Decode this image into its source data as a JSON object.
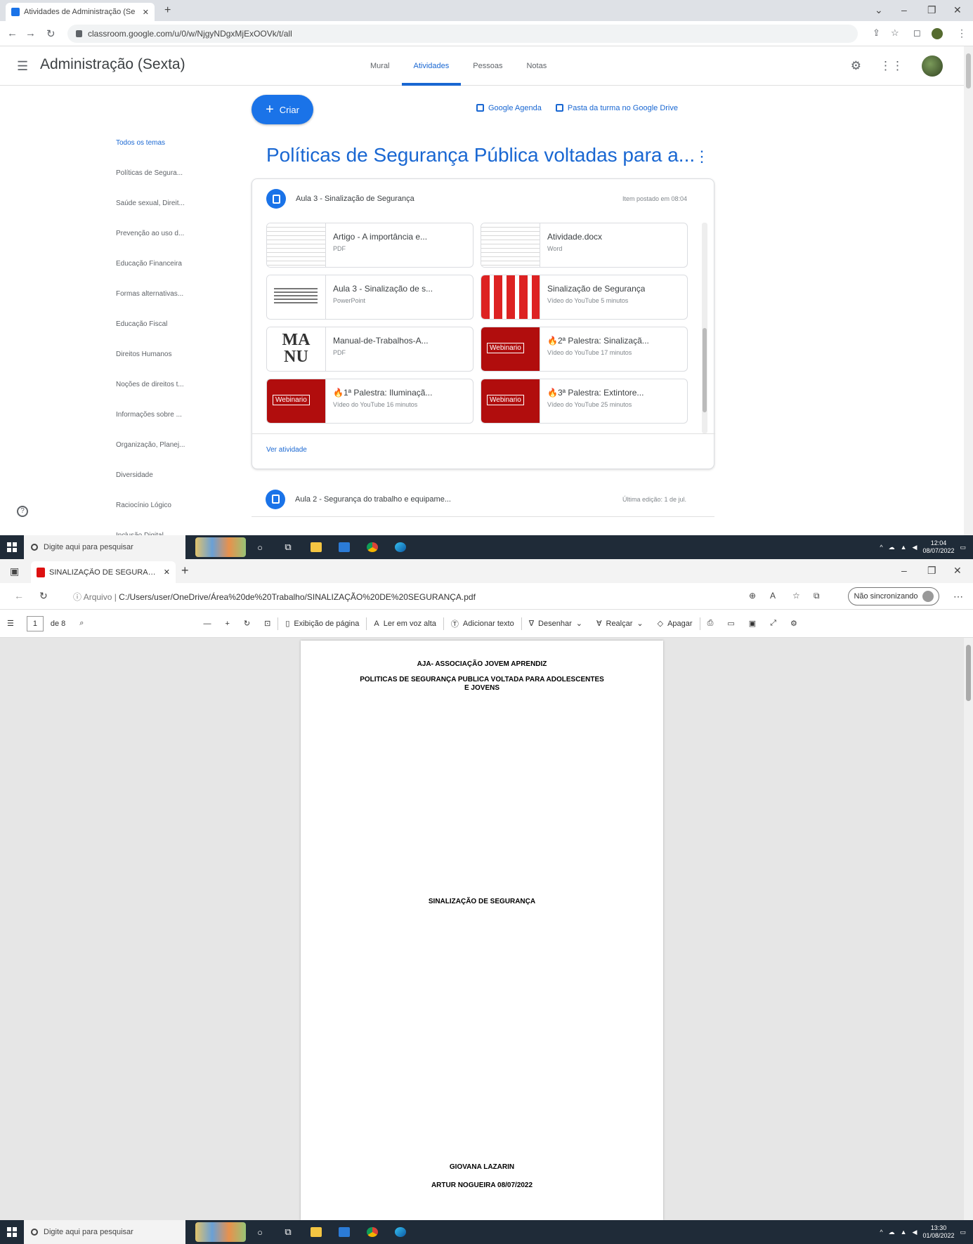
{
  "chrome": {
    "tab_title": "Atividades de Administração (Se",
    "url": "classroom.google.com/u/0/w/NjgyNDgxMjExOOVk/t/all",
    "class_name": "Administração (Sexta)",
    "tabs": [
      "Mural",
      "Atividades",
      "Pessoas",
      "Notas"
    ],
    "active_tab": "Atividades",
    "create_label": "Criar",
    "calendar_link": "Google Agenda",
    "drive_link": "Pasta da turma no Google Drive",
    "sidebar": [
      "Todos os temas",
      "Políticas de Segura...",
      "Saúde sexual, Direit...",
      "Prevenção ao uso d...",
      "Educação Financeira",
      "Formas alternativas...",
      "Educação Fiscal",
      "Direitos Humanos",
      "Noções de direitos t...",
      "Informações sobre ...",
      "Organização, Planej...",
      "Diversidade",
      "Raciocínio Lógico",
      "Inclusão Digital"
    ],
    "topic_title": "Políticas de Segurança Pública voltadas para a...",
    "assignment": {
      "title": "Aula 3 - Sinalização de Segurança",
      "date": "Item postado em 08:04"
    },
    "materials": [
      {
        "name": "Artigo - A importância e...",
        "kind": "PDF",
        "thumb": "doc"
      },
      {
        "name": "Atividade.docx",
        "kind": "Word",
        "thumb": "doc"
      },
      {
        "name": "Aula 3 - Sinalização de s...",
        "kind": "PowerPoint",
        "thumb": "ppt"
      },
      {
        "name": "Sinalização de Segurança",
        "kind": "Vídeo do YouTube  5 minutos",
        "thumb": "signs"
      },
      {
        "name": "Manual-de-Trabalhos-A...",
        "kind": "PDF",
        "thumb": "manu"
      },
      {
        "name": "🔥2ª Palestra: Sinalizaçã...",
        "kind": "Vídeo do YouTube  17 minutos",
        "thumb": "yt"
      },
      {
        "name": "🔥1ª Palestra: Iluminaçã...",
        "kind": "Vídeo do YouTube  16 minutos",
        "thumb": "yt"
      },
      {
        "name": "🔥3ª Palestra: Extintore...",
        "kind": "Vídeo do YouTube  25 minutos",
        "thumb": "yt"
      }
    ],
    "manu_text": "MA\nNU",
    "view_label": "Ver atividade",
    "next_assignment": {
      "title": "Aula 2 - Segurança do trabalho e equipame...",
      "date": "Última edição: 1 de jul."
    }
  },
  "taskbar1": {
    "search_placeholder": "Digite aqui para pesquisar",
    "time": "12:04",
    "date": "08/07/2022"
  },
  "edge": {
    "tab_title": "SINALIZAÇÃO DE SEGURANÇA.pdf",
    "address_prefix": "Arquivo",
    "address": "C:/Users/user/OneDrive/Área%20de%20Trabalho/SINALIZAÇÃO%20DE%20SEGURANÇA.pdf",
    "sync_label": "Não sincronizando",
    "page_current": "1",
    "page_total": "de 8",
    "tools": [
      "Exibição de página",
      "Ler em voz alta",
      "Adicionar texto",
      "Desenhar",
      "Realçar",
      "Apagar"
    ]
  },
  "pdf": {
    "org": "AJA- ASSOCIAÇÃO JOVEM APRENDIZ",
    "title_line1": "POLITICAS DE SEGURANÇA PUBLICA VOLTADA PARA ADOLESCENTES",
    "title_line2": "E JOVENS",
    "subject": "SINALIZAÇÃO DE SEGURANÇA",
    "author": "GIOVANA LAZARIN",
    "place_date": "ARTUR NOGUEIRA 08/07/2022"
  },
  "taskbar2": {
    "search_placeholder": "Digite aqui para pesquisar",
    "time": "13:30",
    "date": "01/08/2022"
  },
  "colors": {
    "accent": "#1967d2",
    "create": "#1a73e8",
    "taskbar": "#1f2b38"
  }
}
